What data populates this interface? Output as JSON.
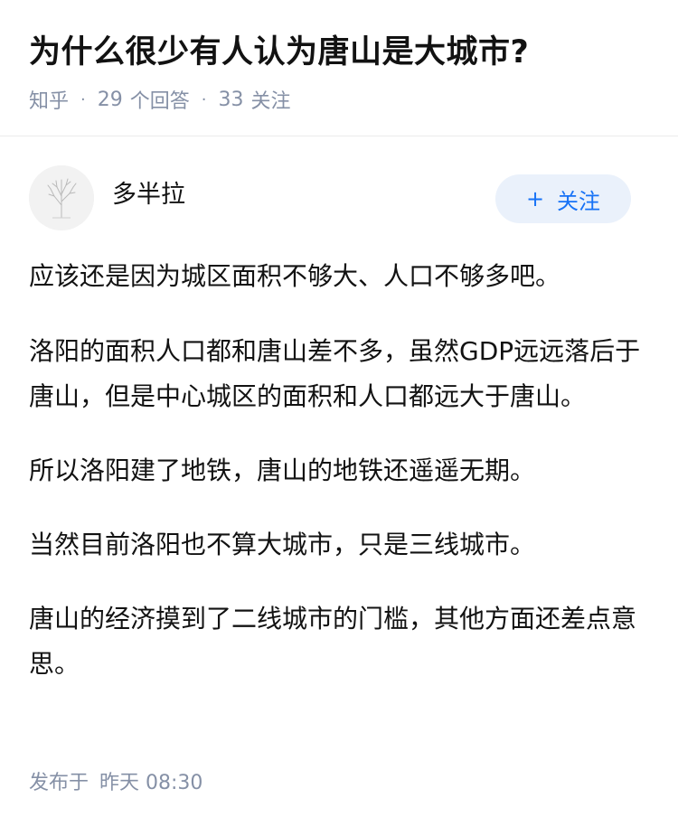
{
  "question": {
    "title": "为什么很少有人认为唐山是大城市?",
    "meta": {
      "source": "知乎",
      "answers_count": "29",
      "answers_label": "个回答",
      "followers_count": "33",
      "followers_label": "关注",
      "separator": "·"
    }
  },
  "author": {
    "name": "多半拉",
    "follow_plus": "+",
    "follow_label": "关注"
  },
  "answer": {
    "paragraphs": [
      "应该还是因为城区面积不够大、人口不够多吧。",
      "洛阳的面积人口都和唐山差不多，虽然GDP远远落后于唐山，但是中心城区的面积和人口都远大于唐山。",
      "所以洛阳建了地铁，唐山的地铁还遥遥无期。",
      "当然目前洛阳也不算大城市，只是三线城市。",
      "唐山的经济摸到了二线城市的门槛，其他方面还差点意思。"
    ],
    "published_label": "发布于",
    "published_time": "昨天 08:30"
  },
  "colors": {
    "text_primary": "#121212",
    "text_secondary": "#8590a6",
    "accent": "#1772f6",
    "follow_bg": "#eaf1fb",
    "divider": "#ebebeb"
  },
  "icons": {
    "avatar": "bare-tree-avatar",
    "follow": "plus-icon"
  }
}
